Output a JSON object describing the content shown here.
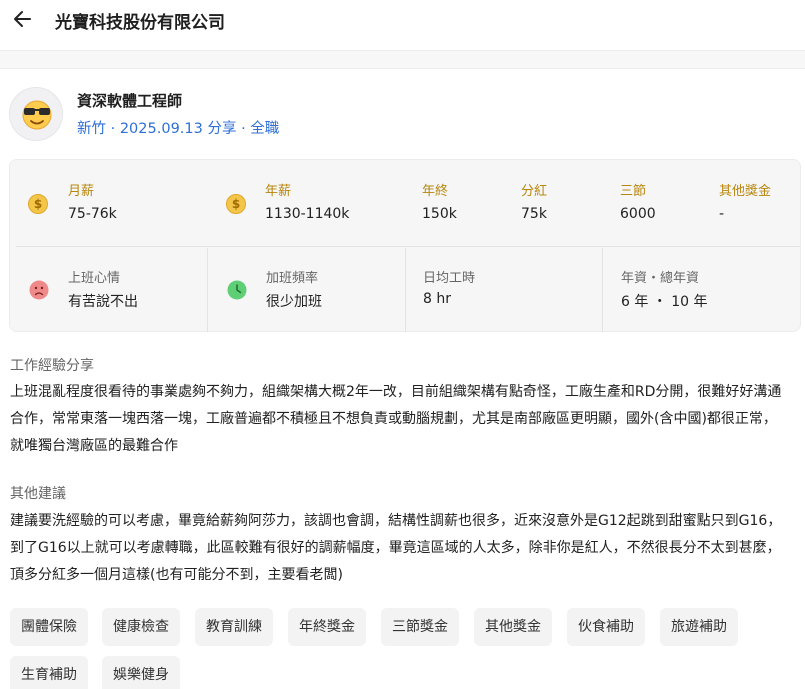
{
  "header": {
    "back_icon": "arrow-left-icon",
    "company_name": "光寶科技股份有限公司"
  },
  "post": {
    "avatar_icon": "sunglasses-emoji-icon",
    "job_title": "資深軟體工程師",
    "meta": "新竹 · 2025.09.13 分享 · 全職"
  },
  "stats": {
    "monthly_salary": {
      "label": "月薪",
      "value": "75-76k",
      "icon": "dollar-coin-icon"
    },
    "annual_salary": {
      "label": "年薪",
      "value": "1130-1140k",
      "icon": "dollar-coin-icon"
    },
    "year_end_bonus": {
      "label": "年終",
      "value": "150k"
    },
    "dividend": {
      "label": "分紅",
      "value": "75k"
    },
    "festival_bonus": {
      "label": "三節",
      "value": "6000"
    },
    "other_bonus": {
      "label": "其他獎金",
      "value": "-"
    },
    "mood": {
      "label": "上班心情",
      "value": "有苦說不出",
      "icon": "sad-face-icon"
    },
    "overtime": {
      "label": "加班頻率",
      "value": "很少加班",
      "icon": "clock-icon"
    },
    "daily_hours": {
      "label": "日均工時",
      "value": "8 hr"
    },
    "seniority": {
      "label": "年資・總年資",
      "value": "6 年 ・ 10 年"
    }
  },
  "experience": {
    "heading": "工作經驗分享",
    "body": "上班混亂程度很看待的事業處夠不夠力，組織架構大概2年一改，目前組織架構有點奇怪，工廠生產和RD分開，很難好好溝通合作，常常東落一塊西落一塊，工廠普遍都不積極且不想負責或動腦規劃，尤其是南部廠區更明顯，國外(含中國)都很正常，就唯獨台灣廠區的最難合作"
  },
  "advice": {
    "heading": "其他建議",
    "body": "建議要洗經驗的可以考慮，畢竟給薪夠阿莎力，該調也會調，結構性調薪也很多，近來沒意外是G12起跳到甜蜜點只到G16，到了G16以上就可以考慮轉職，此區較難有很好的調薪幅度，畢竟這區域的人太多，除非你是紅人，不然很長分不太到甚麼，頂多分紅多一個月這樣(也有可能分不到，主要看老闆)"
  },
  "benefits": [
    "團體保險",
    "健康檢查",
    "教育訓練",
    "年終獎金",
    "三節獎金",
    "其他獎金",
    "伙食補助",
    "旅遊補助",
    "生育補助",
    "娛樂健身"
  ],
  "colors": {
    "link_blue": "#2f6fd6",
    "gold_label": "#b8860b",
    "coin": "#f3c64a",
    "sad_red": "#f08a8a",
    "clock_green": "#5fcf76"
  }
}
